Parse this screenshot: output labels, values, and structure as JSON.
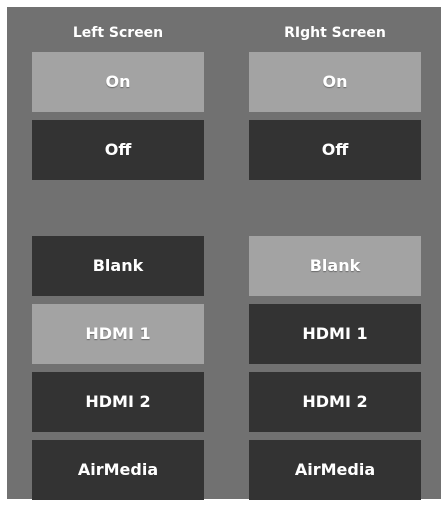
{
  "left": {
    "title": "Left Screen",
    "power": {
      "on": "On",
      "off": "Off",
      "active": "on"
    },
    "sources": [
      "Blank",
      "HDMI 1",
      "HDMI 2",
      "AirMedia"
    ],
    "active_source": "HDMI 1"
  },
  "right": {
    "title": "RIght Screen",
    "power": {
      "on": "On",
      "off": "Off",
      "active": "on"
    },
    "sources": [
      "Blank",
      "HDMI 1",
      "HDMI 2",
      "AirMedia"
    ],
    "active_source": "Blank"
  },
  "colors": {
    "panel_bg": "#717171",
    "button_inactive": "#333333",
    "button_active": "#a3a3a3",
    "text": "#ffffff"
  }
}
